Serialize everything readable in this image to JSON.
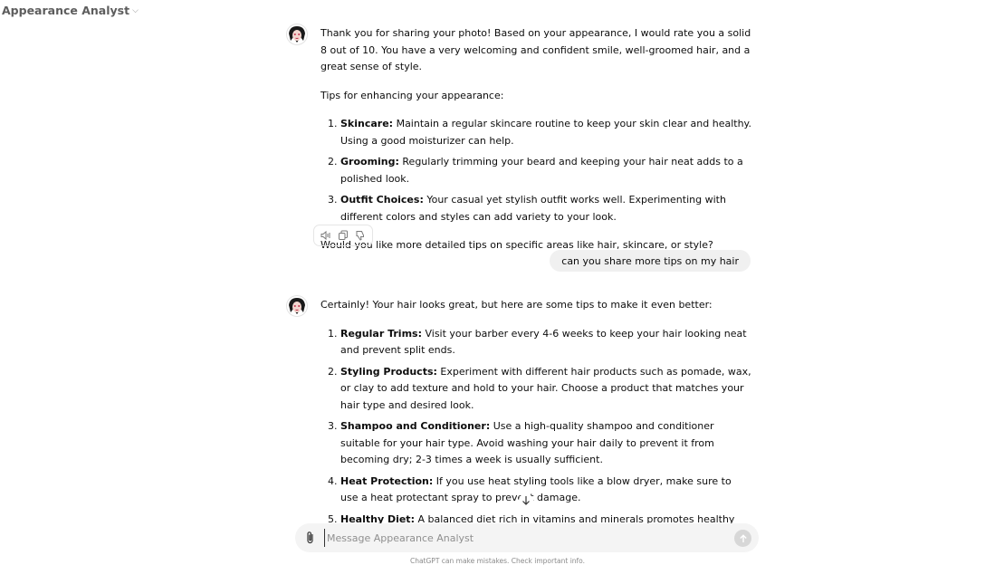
{
  "header": {
    "title": "Appearance Analyst"
  },
  "messages": {
    "first": {
      "intro": "Thank you for sharing your photo! Based on your appearance, I would rate you a solid 8 out of 10. You have a very welcoming and confident smile, well-groomed hair, and a great sense of style.",
      "tips_heading": "Tips for enhancing your appearance:",
      "tips": [
        {
          "title": "Skincare:",
          "text": " Maintain a regular skincare routine to keep your skin clear and healthy. Using a good moisturizer can help."
        },
        {
          "title": "Grooming:",
          "text": " Regularly trimming your beard and keeping your hair neat adds to a polished look."
        },
        {
          "title": "Outfit Choices:",
          "text": " Your casual yet stylish outfit works well. Experimenting with different colors and styles can add variety to your look."
        }
      ],
      "closing": "Would you like more detailed tips on specific areas like hair, skincare, or style?"
    },
    "user": {
      "text": "can you share more tips on my hair"
    },
    "second": {
      "intro": "Certainly! Your hair looks great, but here are some tips to make it even better:",
      "tips": [
        {
          "title": "Regular Trims:",
          "text": " Visit your barber every 4-6 weeks to keep your hair looking neat and prevent split ends."
        },
        {
          "title": "Styling Products:",
          "text": " Experiment with different hair products such as pomade, wax, or clay to add texture and hold to your hair. Choose a product that matches your hair type and desired look."
        },
        {
          "title": "Shampoo and Conditioner:",
          "text": " Use a high-quality shampoo and conditioner suitable for your hair type. Avoid washing your hair daily to prevent it from becoming dry; 2-3 times a week is usually sufficient."
        },
        {
          "title": "Heat Protection:",
          "text": " If you use heat styling tools like a blow dryer, make sure to use a heat protectant spray to prevent damage."
        },
        {
          "title": "Healthy Diet:",
          "text": " A balanced diet rich in vitamins and minerals promotes healthy hair growth. Foods like eggs, nuts, and leafy greens are particularly beneficial."
        }
      ]
    }
  },
  "composer": {
    "placeholder": "Message Appearance Analyst"
  },
  "footer": {
    "text": "ChatGPT can make mistakes. Check important info."
  },
  "icons": {
    "chevron": "chevron-down-icon",
    "read_aloud": "speaker-icon",
    "copy": "copy-icon",
    "thumbs_down": "thumbs-down-icon",
    "attach": "paperclip-icon",
    "send": "arrow-up-icon",
    "scroll": "arrow-down-icon"
  },
  "colors": {
    "bubble": "#f0f0f0",
    "composer": "#f4f4f4",
    "send_disabled": "#d7d7d7",
    "text": "#0d0d0d"
  }
}
